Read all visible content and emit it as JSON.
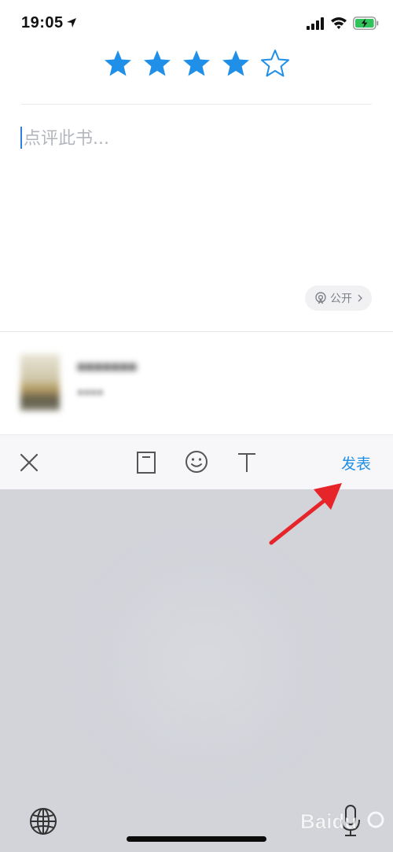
{
  "status_bar": {
    "time": "19:05"
  },
  "rating": {
    "value": 4,
    "max": 5,
    "color": "#1f8fe7"
  },
  "review": {
    "placeholder": "点评此书...",
    "value": ""
  },
  "visibility": {
    "label": "公开"
  },
  "toolbar": {
    "publish_label": "发表",
    "accent": "#1e8fe6",
    "icons": [
      "close-icon",
      "bookmark-icon",
      "emoji-icon",
      "text-format-icon"
    ]
  },
  "keyboard": {
    "icons": [
      "globe-icon",
      "microphone-icon"
    ]
  },
  "watermark": {
    "label": "Baidu"
  }
}
